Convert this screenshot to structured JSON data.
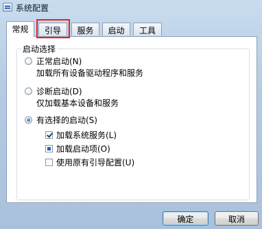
{
  "window": {
    "title": "系统配置"
  },
  "tabs": [
    {
      "label": "常规",
      "active": true
    },
    {
      "label": "引导",
      "active": false,
      "highlighted": true
    },
    {
      "label": "服务",
      "active": false
    },
    {
      "label": "启动",
      "active": false
    },
    {
      "label": "工具",
      "active": false
    }
  ],
  "startup_selection": {
    "group_title": "启动选择",
    "options": [
      {
        "label": "正常启动(N)",
        "description": "加载所有设备驱动程序和服务",
        "selected": false
      },
      {
        "label": "诊断启动(D)",
        "description": "仅加载基本设备和服务",
        "selected": false
      },
      {
        "label": "有选择的启动(S)",
        "selected": true
      }
    ],
    "sub_options": [
      {
        "label": "加载系统服务(L)",
        "state": "checked"
      },
      {
        "label": "加载启动项(O)",
        "state": "indeterminate"
      },
      {
        "label": "使用原有引导配置(U)",
        "state": "unchecked"
      }
    ]
  },
  "buttons": {
    "ok": "确定",
    "cancel": "取消"
  },
  "colors": {
    "highlight": "#e82020"
  }
}
